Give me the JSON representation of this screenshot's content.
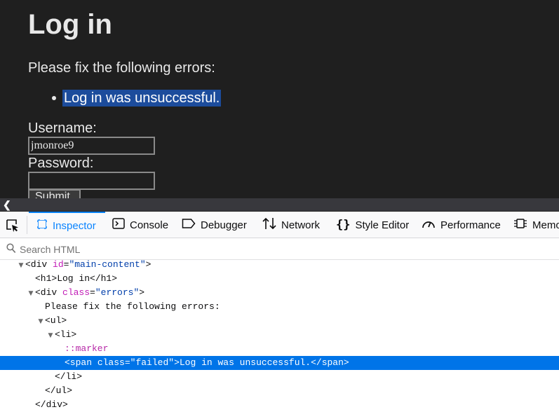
{
  "page": {
    "title": "Log in",
    "error_intro": "Please fix the following errors:",
    "error_message": "Log in was unsuccessful.",
    "username_label": "Username:",
    "username_value": "jmonroe9",
    "password_label": "Password:",
    "password_value": "",
    "submit_label": "Submit"
  },
  "devtools": {
    "tabs": [
      {
        "label": "Inspector",
        "icon": "inspector-icon",
        "selected": true
      },
      {
        "label": "Console",
        "icon": "console-icon"
      },
      {
        "label": "Debugger",
        "icon": "debugger-icon"
      },
      {
        "label": "Network",
        "icon": "network-icon"
      },
      {
        "label": "Style Editor",
        "icon": "style-editor-icon"
      },
      {
        "label": "Performance",
        "icon": "performance-icon"
      },
      {
        "label": "Memo",
        "icon": "memory-icon"
      }
    ],
    "search_placeholder": "Search HTML",
    "colors": {
      "accent": "#0a84ff",
      "selected_row": "#0074e8",
      "text_selection": "#1c4c9c"
    },
    "markup": [
      {
        "twisty": "▼",
        "text": "<div id=\"main-content\">"
      },
      {
        "twisty": "",
        "text": "<h1>Log in</h1>"
      },
      {
        "twisty": "▼",
        "text": "<div class=\"errors\">"
      },
      {
        "twisty": "",
        "text": "Please fix the following errors:"
      },
      {
        "twisty": "▼",
        "text": "<ul>"
      },
      {
        "twisty": "▼",
        "text": "<li>"
      },
      {
        "twisty": "",
        "text": "::marker"
      },
      {
        "twisty": "",
        "text": "<span class=\"failed\">Log in was unsuccessful.</span>",
        "selected": true
      },
      {
        "twisty": "",
        "text": "</li>"
      },
      {
        "twisty": "",
        "text": "</ul>"
      },
      {
        "twisty": "",
        "text": "</div>"
      }
    ]
  }
}
